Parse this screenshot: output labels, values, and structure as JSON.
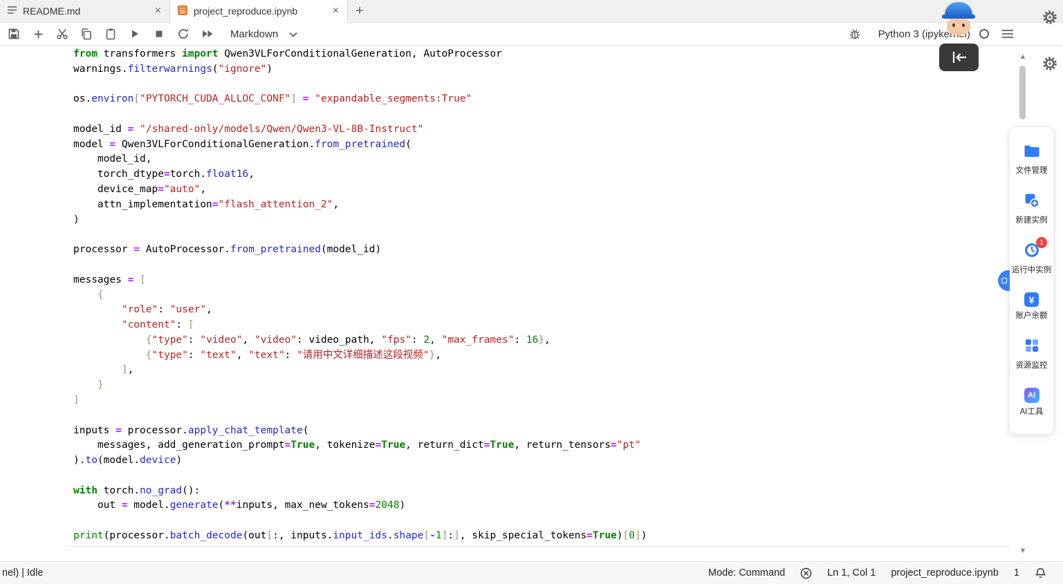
{
  "tabs": [
    {
      "label": "README.md",
      "close": "×",
      "active": false
    },
    {
      "label": "project_reproduce.ipynb",
      "close": "×",
      "active": true
    }
  ],
  "new_tab_label": "+",
  "toolbar": {
    "cell_type": "Markdown",
    "kernel_name": "Python 3 (ipykernel)"
  },
  "sidebar": {
    "items": [
      {
        "label": "文件管理",
        "icon": "folder-icon"
      },
      {
        "label": "新建实例",
        "icon": "new-instance-icon"
      },
      {
        "label": "运行中实例",
        "icon": "running-instance-icon",
        "badge": "1"
      },
      {
        "label": "账户余额",
        "icon": "balance-icon"
      },
      {
        "label": "资源监控",
        "icon": "monitor-icon"
      },
      {
        "label": "AI工具",
        "icon": "ai-tools-icon"
      }
    ]
  },
  "statusbar": {
    "left": "nel) | Idle",
    "mode": "Mode: Command",
    "line_col": "Ln 1, Col 1",
    "filename": "project_reproduce.ipynb",
    "notification_count": "1"
  },
  "colors": {
    "notebook_orange": "#f37726",
    "sidebar_blue": "#2f7cf6",
    "badge_red": "#f53f3f",
    "keyword": "#008000",
    "string": "#ba2121",
    "number": "#008000",
    "function": "#2525d2",
    "operator": "#aa22ff",
    "bracket": "#999977"
  },
  "code": {
    "lines": [
      [
        [
          "k",
          "from"
        ],
        [
          "p",
          " transformers "
        ],
        [
          "k",
          "import"
        ],
        [
          "p",
          " Qwen3VLForConditionalGeneration, AutoProcessor"
        ]
      ],
      [
        [
          "p",
          "warnings."
        ],
        [
          "f",
          "filterwarnings"
        ],
        [
          "p",
          "("
        ],
        [
          "s",
          "\"ignore\""
        ],
        [
          "p",
          ")"
        ]
      ],
      [],
      [
        [
          "p",
          "os."
        ],
        [
          "f",
          "environ"
        ],
        [
          "b",
          "["
        ],
        [
          "s",
          "\"PYTORCH_CUDA_ALLOC_CONF\""
        ],
        [
          "b",
          "]"
        ],
        [
          "p",
          " "
        ],
        [
          "o",
          "="
        ],
        [
          "p",
          " "
        ],
        [
          "s",
          "\"expandable_segments:True\""
        ]
      ],
      [],
      [
        [
          "p",
          "model_id "
        ],
        [
          "o",
          "="
        ],
        [
          "p",
          " "
        ],
        [
          "s",
          "\"/shared-only/models/Qwen/Qwen3-VL-8B-Instruct\""
        ]
      ],
      [
        [
          "p",
          "model "
        ],
        [
          "o",
          "="
        ],
        [
          "p",
          " Qwen3VLForConditionalGeneration."
        ],
        [
          "f",
          "from_pretrained"
        ],
        [
          "p",
          "("
        ]
      ],
      [
        [
          "p",
          "    model_id,"
        ]
      ],
      [
        [
          "p",
          "    torch_dtype"
        ],
        [
          "o",
          "="
        ],
        [
          "p",
          "torch."
        ],
        [
          "f",
          "float16"
        ],
        [
          "p",
          ","
        ]
      ],
      [
        [
          "p",
          "    device_map"
        ],
        [
          "o",
          "="
        ],
        [
          "s",
          "\"auto\""
        ],
        [
          "p",
          ","
        ]
      ],
      [
        [
          "p",
          "    attn_implementation"
        ],
        [
          "o",
          "="
        ],
        [
          "s",
          "\"flash_attention_2\""
        ],
        [
          "p",
          ","
        ]
      ],
      [
        [
          "p",
          ")"
        ]
      ],
      [],
      [
        [
          "p",
          "processor "
        ],
        [
          "o",
          "="
        ],
        [
          "p",
          " AutoProcessor."
        ],
        [
          "f",
          "from_pretrained"
        ],
        [
          "p",
          "(model_id)"
        ]
      ],
      [],
      [
        [
          "p",
          "messages "
        ],
        [
          "o",
          "="
        ],
        [
          "p",
          " "
        ],
        [
          "b",
          "["
        ]
      ],
      [
        [
          "p",
          "    "
        ],
        [
          "b",
          "{"
        ]
      ],
      [
        [
          "p",
          "        "
        ],
        [
          "s",
          "\"role\""
        ],
        [
          "p",
          ": "
        ],
        [
          "s",
          "\"user\""
        ],
        [
          "p",
          ","
        ]
      ],
      [
        [
          "p",
          "        "
        ],
        [
          "s",
          "\"content\""
        ],
        [
          "p",
          ": "
        ],
        [
          "b",
          "["
        ]
      ],
      [
        [
          "p",
          "            "
        ],
        [
          "b",
          "{"
        ],
        [
          "s",
          "\"type\""
        ],
        [
          "p",
          ": "
        ],
        [
          "s",
          "\"video\""
        ],
        [
          "p",
          ", "
        ],
        [
          "s",
          "\"video\""
        ],
        [
          "p",
          ": video_path, "
        ],
        [
          "s",
          "\"fps\""
        ],
        [
          "p",
          ": "
        ],
        [
          "n",
          "2"
        ],
        [
          "p",
          ", "
        ],
        [
          "s",
          "\"max_frames\""
        ],
        [
          "p",
          ": "
        ],
        [
          "n",
          "16"
        ],
        [
          "b",
          "}"
        ],
        [
          "p",
          ","
        ]
      ],
      [
        [
          "p",
          "            "
        ],
        [
          "b",
          "{"
        ],
        [
          "s",
          "\"type\""
        ],
        [
          "p",
          ": "
        ],
        [
          "s",
          "\"text\""
        ],
        [
          "p",
          ", "
        ],
        [
          "s",
          "\"text\""
        ],
        [
          "p",
          ": "
        ],
        [
          "s",
          "\"请用中文详细描述这段视频\""
        ],
        [
          "b",
          "}"
        ],
        [
          "p",
          ","
        ]
      ],
      [
        [
          "p",
          "        "
        ],
        [
          "b",
          "]"
        ],
        [
          "p",
          ","
        ]
      ],
      [
        [
          "p",
          "    "
        ],
        [
          "b",
          "}"
        ]
      ],
      [
        [
          "b",
          "]"
        ]
      ],
      [],
      [
        [
          "p",
          "inputs "
        ],
        [
          "o",
          "="
        ],
        [
          "p",
          " processor."
        ],
        [
          "f",
          "apply_chat_template"
        ],
        [
          "p",
          "("
        ]
      ],
      [
        [
          "p",
          "    messages, add_generation_prompt"
        ],
        [
          "o",
          "="
        ],
        [
          "k",
          "True"
        ],
        [
          "p",
          ", tokenize"
        ],
        [
          "o",
          "="
        ],
        [
          "k",
          "True"
        ],
        [
          "p",
          ", return_dict"
        ],
        [
          "o",
          "="
        ],
        [
          "k",
          "True"
        ],
        [
          "p",
          ", return_tensors"
        ],
        [
          "o",
          "="
        ],
        [
          "s",
          "\"pt\""
        ]
      ],
      [
        [
          "p",
          ")."
        ],
        [
          "f",
          "to"
        ],
        [
          "p",
          "(model."
        ],
        [
          "f",
          "device"
        ],
        [
          "p",
          ")"
        ]
      ],
      [],
      [
        [
          "k",
          "with"
        ],
        [
          "p",
          " torch."
        ],
        [
          "f",
          "no_grad"
        ],
        [
          "p",
          "():"
        ]
      ],
      [
        [
          "p",
          "    out "
        ],
        [
          "o",
          "="
        ],
        [
          "p",
          " model."
        ],
        [
          "f",
          "generate"
        ],
        [
          "p",
          "("
        ],
        [
          "o",
          "**"
        ],
        [
          "p",
          "inputs, max_new_tokens"
        ],
        [
          "o",
          "="
        ],
        [
          "n",
          "2048"
        ],
        [
          "p",
          ")"
        ]
      ],
      [],
      [
        [
          "bi",
          "print"
        ],
        [
          "p",
          "(processor."
        ],
        [
          "f",
          "batch_decode"
        ],
        [
          "p",
          "(out"
        ],
        [
          "b",
          "["
        ],
        [
          "p",
          ":, inputs."
        ],
        [
          "f",
          "input_ids"
        ],
        [
          "p",
          "."
        ],
        [
          "f",
          "shape"
        ],
        [
          "b",
          "["
        ],
        [
          "o",
          "-"
        ],
        [
          "n",
          "1"
        ],
        [
          "b",
          "]"
        ],
        [
          "p",
          ":"
        ],
        [
          "b",
          "]"
        ],
        [
          "p",
          ", skip_special_tokens"
        ],
        [
          "o",
          "="
        ],
        [
          "k",
          "True"
        ],
        [
          "p",
          ")"
        ],
        [
          "b",
          "["
        ],
        [
          "n",
          "0"
        ],
        [
          "b",
          "]"
        ],
        [
          "p",
          ")"
        ]
      ]
    ]
  }
}
